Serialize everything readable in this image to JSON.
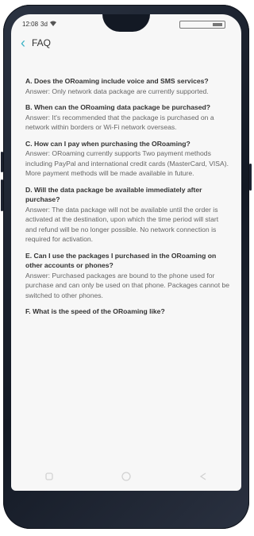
{
  "status": {
    "time": "12:08",
    "signal": "3d",
    "wifi": "wifi-icon"
  },
  "header": {
    "back_icon": "chevron-left-icon",
    "title": "FAQ"
  },
  "faq": [
    {
      "question": "A. Does the ORoaming include voice and SMS services?",
      "answer": "Answer: Only network data package are currently supported."
    },
    {
      "question": "B. When can the ORoaming data package be purchased?",
      "answer": "Answer: It's recommended that the package is purchased on a network within borders or Wi-Fi network overseas."
    },
    {
      "question": "C. How can I pay when purchasing the ORoaming?",
      "answer": "Answer: ORoaming currently supports Two payment methods including PayPal and international credit cards (MasterCard, VISA). More payment methods will be made available in future."
    },
    {
      "question": "D. Will the data package be available immediately after purchase?",
      "answer": "Answer: The data package will not be available until the order is activated at the destination, upon which the time period will start and refund will be no longer possible. No network connection is required for activation."
    },
    {
      "question": "E. Can I use the packages I purchased in the ORoaming on other accounts or phones?",
      "answer": "Answer: Purchased packages are bound to the phone used for purchase and can only be used on that phone. Packages cannot be switched to other phones."
    },
    {
      "question": "F. What is the speed of the ORoaming like?",
      "answer": ""
    }
  ],
  "navbar": {
    "left": "square-icon",
    "home": "circle-icon",
    "back": "back-triangle-icon"
  },
  "colors": {
    "accent": "#3bb2c4"
  }
}
